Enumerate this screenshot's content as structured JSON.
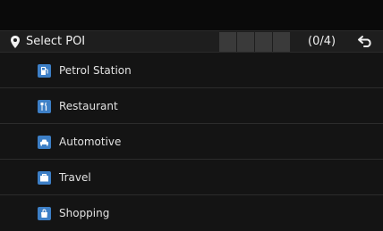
{
  "header": {
    "title": "Select POI",
    "counter": "(0/4)",
    "slot_count": 4
  },
  "poi_list": [
    {
      "label": "Petrol Station",
      "icon": "fuel-pump-icon"
    },
    {
      "label": "Restaurant",
      "icon": "fork-knife-icon"
    },
    {
      "label": "Automotive",
      "icon": "car-icon"
    },
    {
      "label": "Travel",
      "icon": "suitcase-icon"
    },
    {
      "label": "Shopping",
      "icon": "shopping-bag-icon"
    }
  ],
  "colors": {
    "icon_accent": "#3d7fc6",
    "background": "#121212"
  }
}
